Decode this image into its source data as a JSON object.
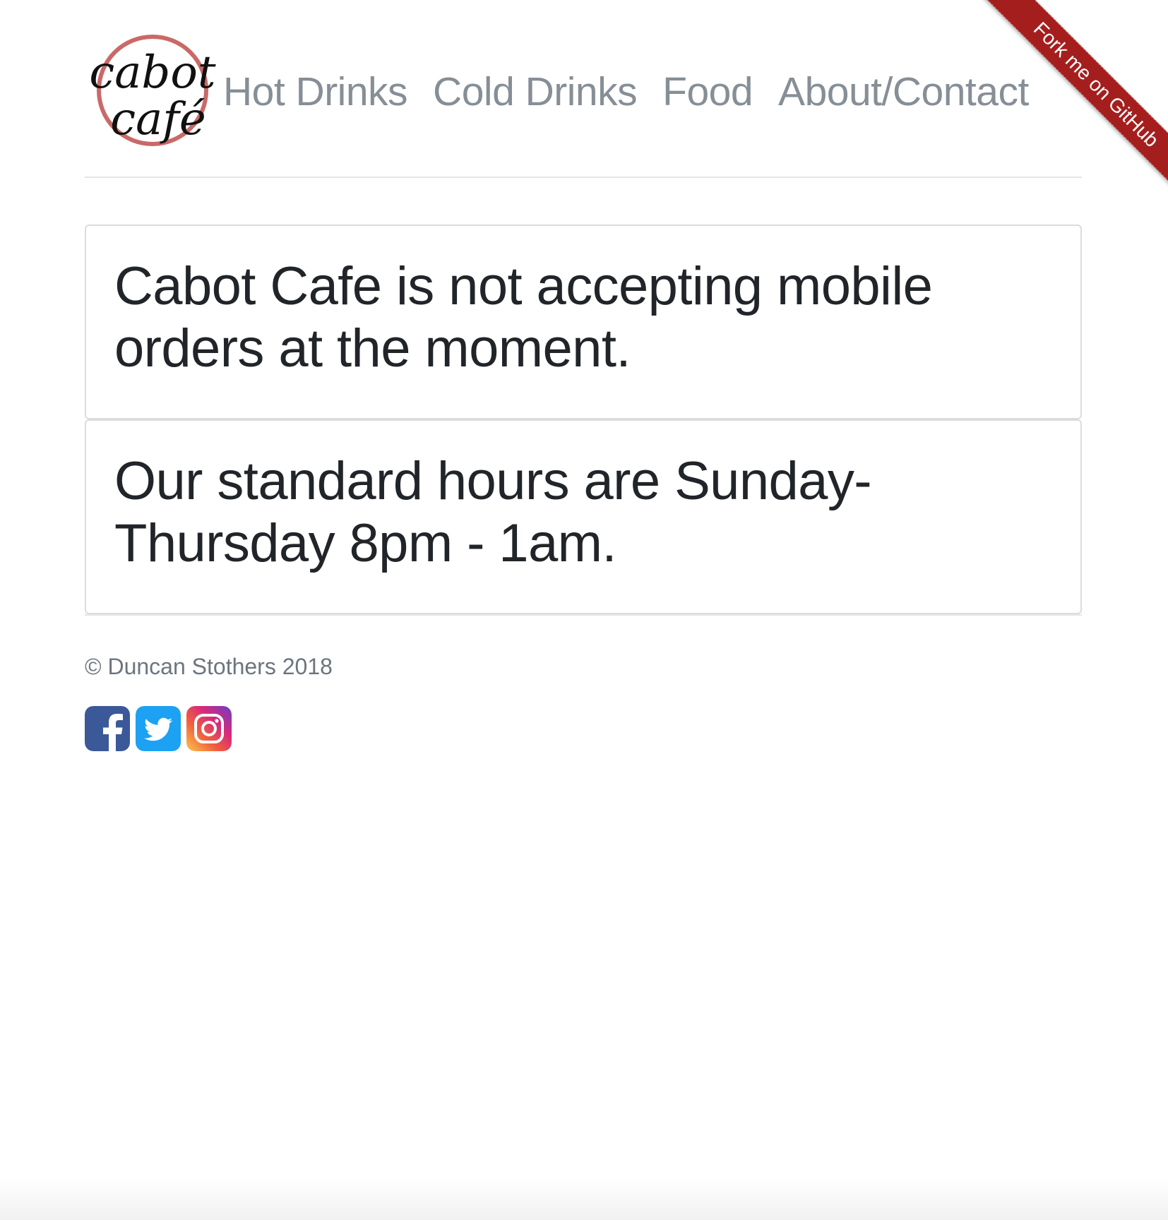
{
  "logo": {
    "alt": "cabot café",
    "line1": "cabot",
    "line2": "café"
  },
  "nav": {
    "items": [
      {
        "label": "Hot Drinks"
      },
      {
        "label": "Cold Drinks"
      },
      {
        "label": "Food"
      },
      {
        "label": "About/Contact"
      }
    ]
  },
  "cards": [
    {
      "text": "Cabot Cafe is not accepting mobile orders at the moment."
    },
    {
      "text": "Our standard hours are Sunday-Thursday 8pm - 1am."
    }
  ],
  "footer": {
    "copyright": "© Duncan Stothers 2018",
    "social": [
      {
        "icon": "facebook-icon"
      },
      {
        "icon": "twitter-icon"
      },
      {
        "icon": "instagram-icon"
      }
    ]
  },
  "ribbon": {
    "label": "Fork me on GitHub",
    "color": "#a51e1e"
  },
  "colors": {
    "nav_link": "#868e96",
    "card_text": "#212529",
    "footer_text": "#6c757d",
    "facebook": "#3b5998",
    "twitter": "#1da1f2"
  }
}
